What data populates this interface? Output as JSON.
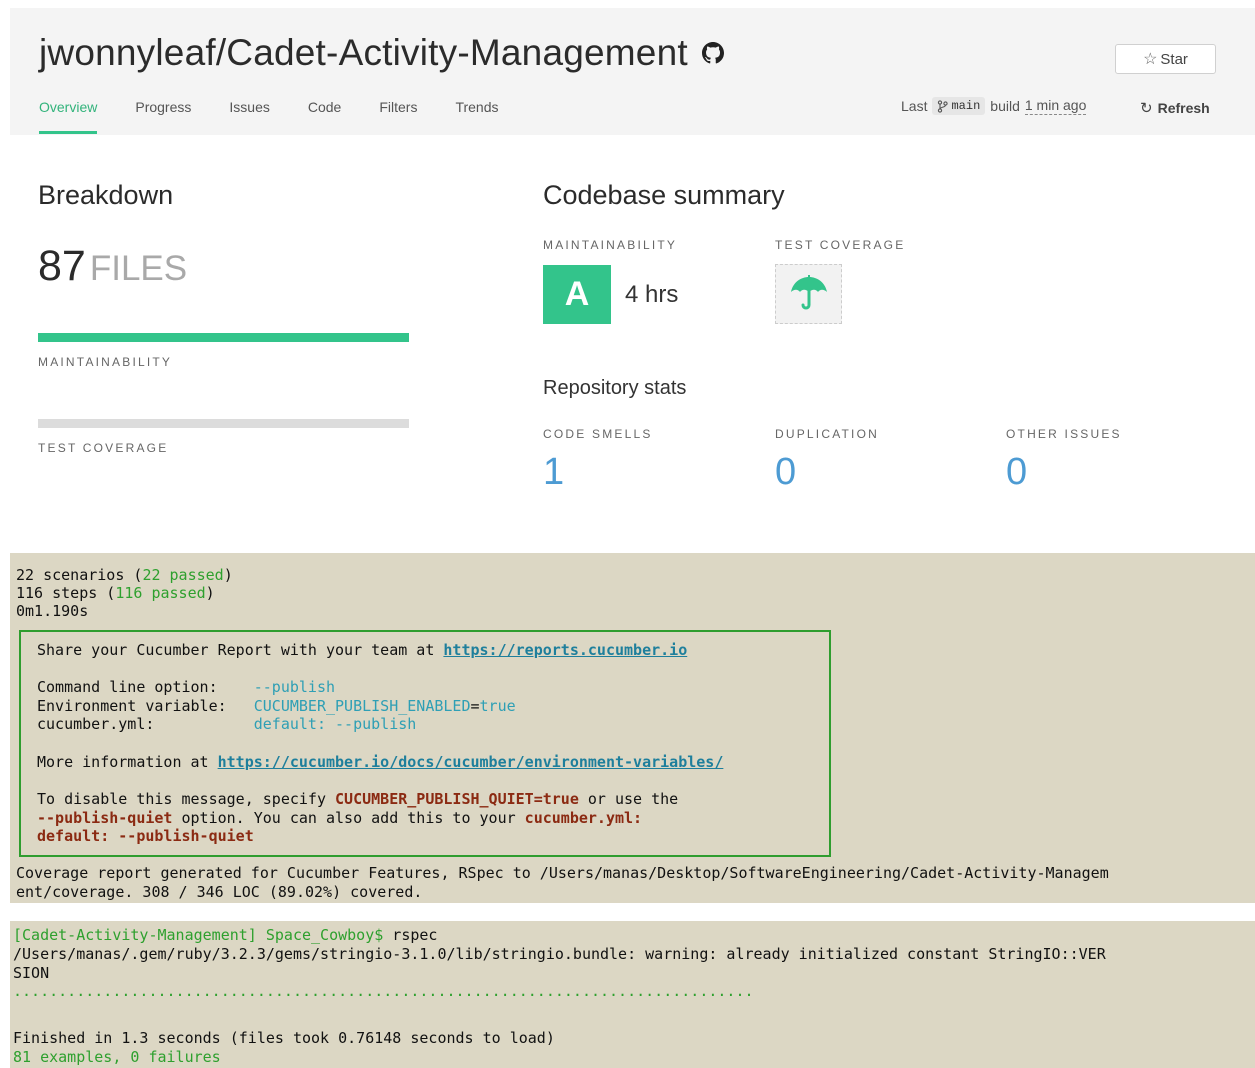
{
  "header": {
    "repo_title": "jwonnyleaf/Cadet-Activity-Management",
    "star_label": "Star",
    "tabs": [
      {
        "label": "Overview",
        "active": true
      },
      {
        "label": "Progress"
      },
      {
        "label": "Issues"
      },
      {
        "label": "Code"
      },
      {
        "label": "Filters"
      },
      {
        "label": "Trends"
      }
    ],
    "build": {
      "prefix": "Last",
      "branch": "main",
      "build_word": "build",
      "ago": "1 min ago"
    },
    "refresh_label": "Refresh"
  },
  "breakdown": {
    "title": "Breakdown",
    "files_count": "87",
    "files_unit": "FILES",
    "maintainability_label": "MAINTAINABILITY",
    "maintainability_fill": 1.0,
    "test_coverage_label": "TEST COVERAGE",
    "test_coverage_fill": 0
  },
  "summary": {
    "title": "Codebase summary",
    "maintainability_label": "MAINTAINABILITY",
    "grade": "A",
    "debt": "4 hrs",
    "test_coverage_label": "TEST COVERAGE",
    "repo_stats_title": "Repository stats",
    "stats": [
      {
        "label": "CODE SMELLS",
        "value": "1"
      },
      {
        "label": "DUPLICATION",
        "value": "0"
      },
      {
        "label": "OTHER ISSUES",
        "value": "0"
      }
    ]
  },
  "colors": {
    "accent": "#33c48b",
    "link_blue": "#4d9bd3",
    "terminal_bg": "#dcd7c4"
  },
  "cucumber": {
    "scenarios_prefix": "22 scenarios (",
    "scenarios_passed": "22 passed",
    "steps_prefix": "116 steps (",
    "steps_passed": "116 passed",
    "close_paren": ")",
    "duration": "0m1.190s",
    "share_text": "Share your Cucumber Report with your team at ",
    "share_link": "https://reports.cucumber.io",
    "opt_cmd_label": "Command line option:    ",
    "opt_cmd_value": "--publish",
    "opt_env_label": "Environment variable:   ",
    "opt_env_name": "CUCUMBER_PUBLISH_ENABLED",
    "opt_env_eq": "=",
    "opt_env_val": "true",
    "opt_yml_label": "cucumber.yml:           ",
    "opt_yml_value": "default: --publish",
    "more_info_text": "More information at ",
    "more_info_link": "https://cucumber.io/docs/cucumber/environment-variables/",
    "disable_a": "To disable this message, specify ",
    "disable_var": "CUCUMBER_PUBLISH_QUIET=true",
    "disable_b": " or use the",
    "disable_opt": "--publish-quiet",
    "disable_c": " option. You can also add this to your ",
    "disable_yml": "cucumber.yml:",
    "disable_default": "default: --publish-quiet",
    "coverage_line1": "Coverage report generated for Cucumber Features, RSpec to /Users/manas/Desktop/SoftwareEngineering/Cadet-Activity-Managem",
    "coverage_line2": "ent/coverage. 308 / 346 LOC (89.02%) covered."
  },
  "rspec": {
    "prompt": "[Cadet-Activity-Management] Space_Cowboy$",
    "command": " rspec",
    "warning_line1": "/Users/manas/.gem/ruby/3.2.3/gems/stringio-3.1.0/lib/stringio.bundle: warning: already initialized constant StringIO::VER",
    "warning_line2": "SION",
    "dots": "..................................................................................",
    "finished": "Finished in 1.3 seconds (files took 0.76148 seconds to load)",
    "summary": "81 examples, 0 failures"
  }
}
